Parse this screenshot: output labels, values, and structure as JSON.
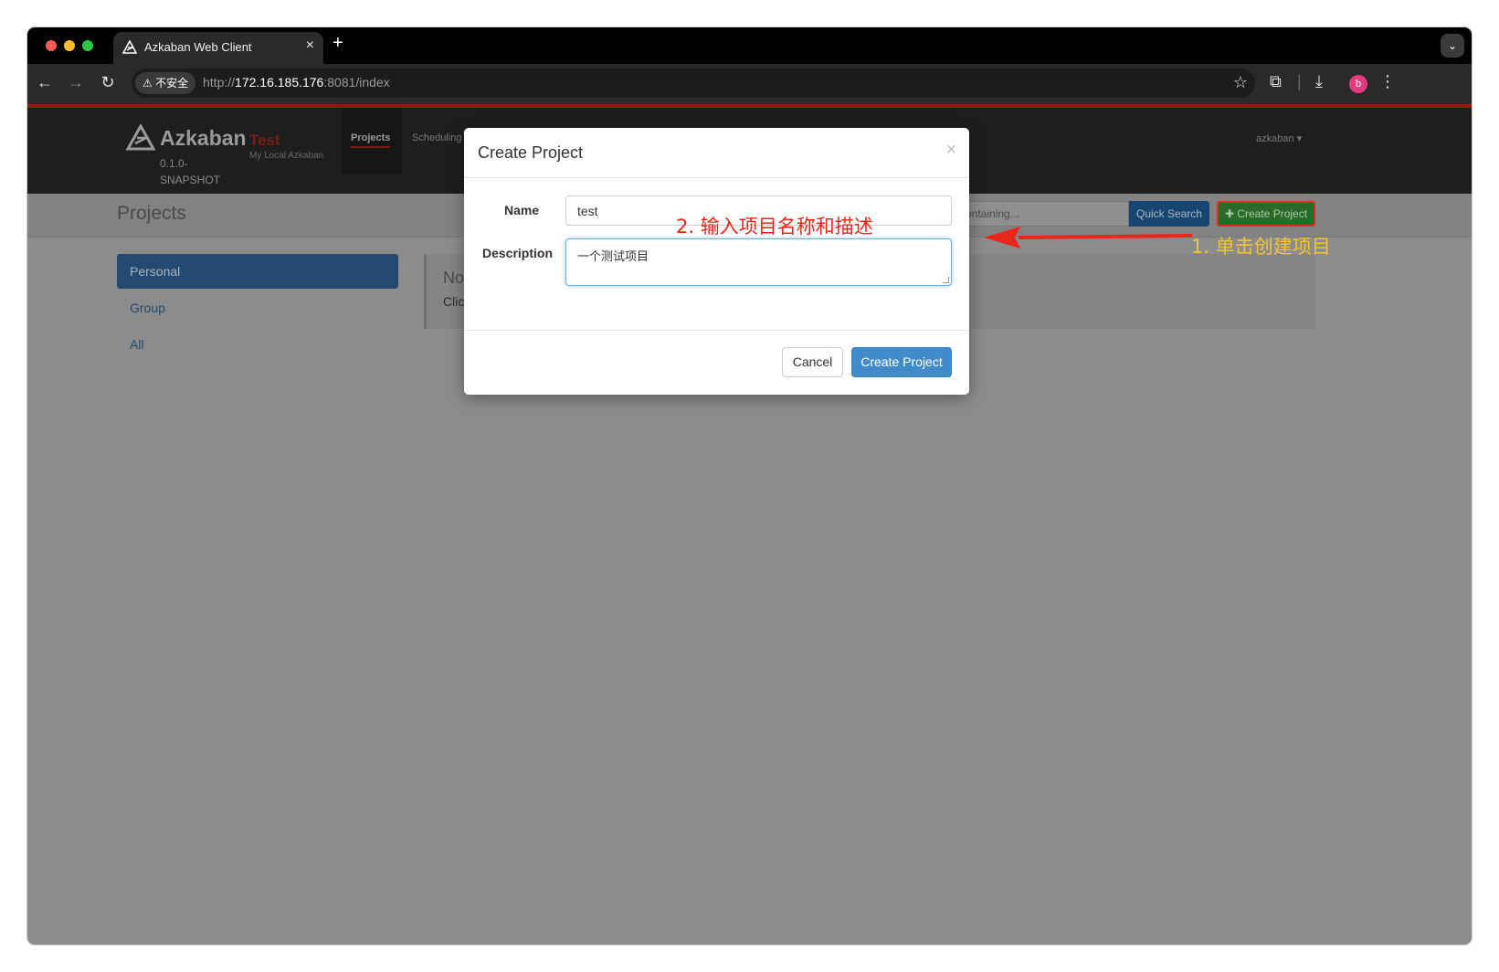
{
  "browser": {
    "tab_title": "Azkaban Web Client",
    "tab_close": "×",
    "new_tab": "+",
    "security_chip": "⚠ 不安全",
    "url_scheme": "http://",
    "url_host": "172.16.185.176",
    "url_rest": ":8081/index"
  },
  "header": {
    "logo_text": "Azkaban",
    "version": "0.1.0-SNAPSHOT",
    "env_name": "Test",
    "env_desc": "My Local Azkaban",
    "nav_projects": "Projects",
    "nav_scheduling": "Scheduling",
    "user": "azkaban ▾"
  },
  "page": {
    "title": "Projects",
    "search_placeholder": "containing...",
    "quick_search": "Quick Search",
    "create_project": "✚ Create Project",
    "sidebar": [
      {
        "label": "Personal"
      },
      {
        "label": "Group"
      },
      {
        "label": "All"
      }
    ],
    "panel_title": "No",
    "panel_text": "Clic"
  },
  "modal": {
    "title": "Create Project",
    "close": "×",
    "name_label": "Name",
    "name_value": "test",
    "description_label": "Description",
    "description_value": "一个测试项目",
    "cancel": "Cancel",
    "submit": "Create Project"
  },
  "annotations": {
    "step1": "1. 单击创建项目",
    "step2": "2. 输入项目名称和描述"
  },
  "colors": {
    "accent_red": "#e8261a",
    "annotation_yellow": "#f2c530",
    "primary_blue": "#428bca"
  }
}
